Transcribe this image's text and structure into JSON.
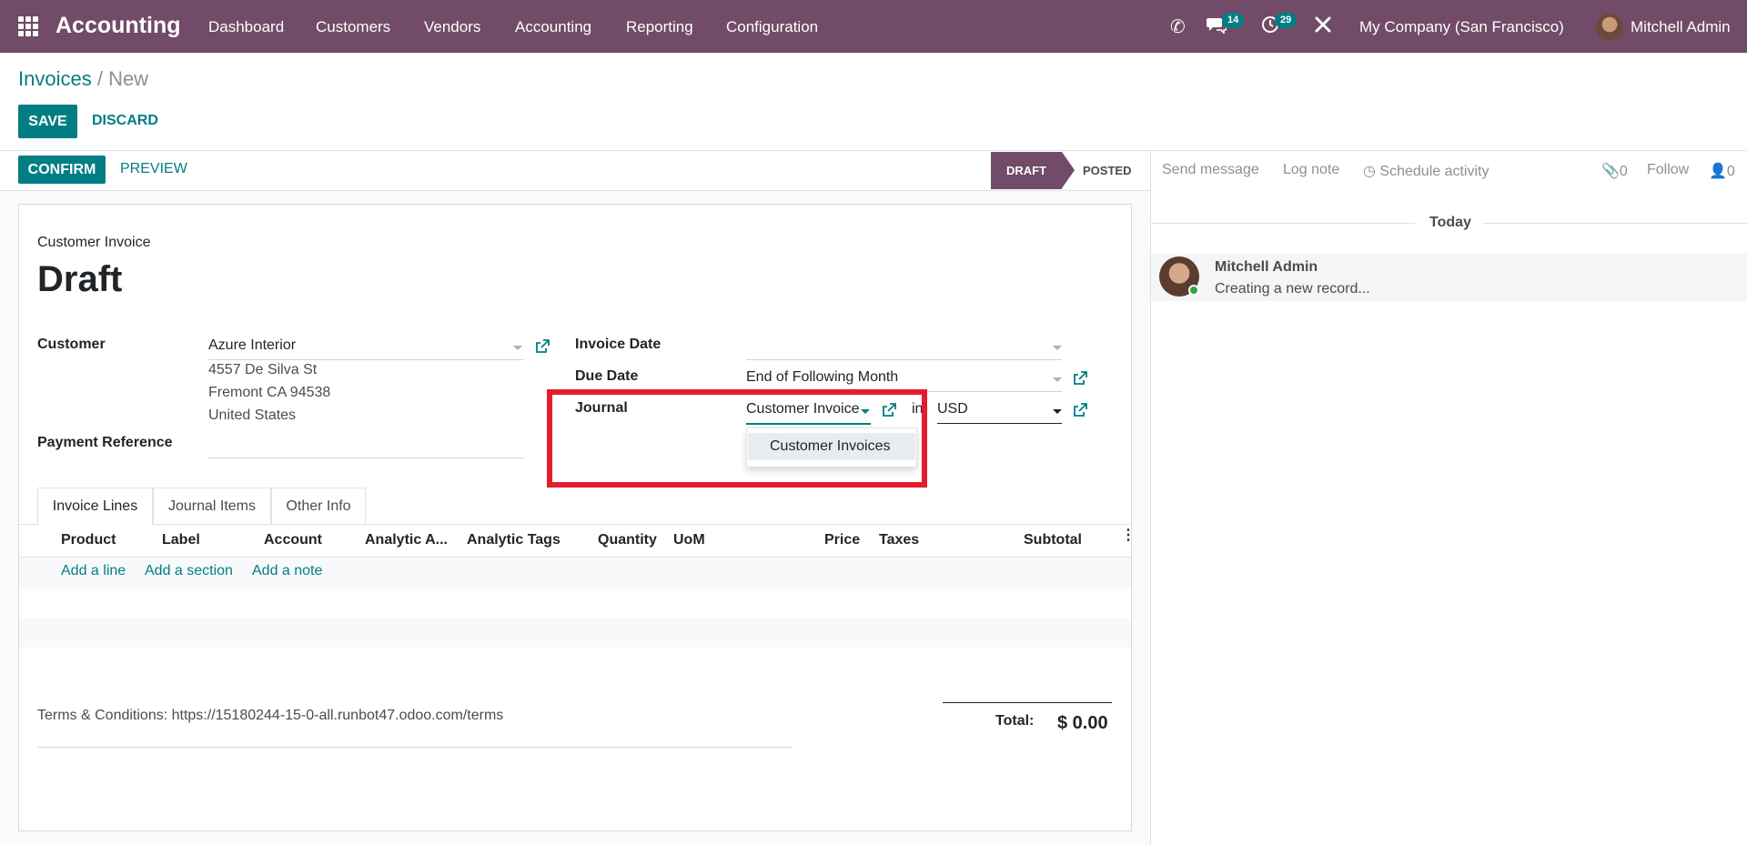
{
  "navbar": {
    "app_name": "Accounting",
    "menu": [
      "Dashboard",
      "Customers",
      "Vendors",
      "Accounting",
      "Reporting",
      "Configuration"
    ],
    "messages_count": "14",
    "activities_count": "29",
    "company": "My Company (San Francisco)",
    "user": "Mitchell Admin"
  },
  "breadcrumb": {
    "parent": "Invoices",
    "separator": " / ",
    "current": "New"
  },
  "buttons": {
    "save": "SAVE",
    "discard": "DISCARD",
    "confirm": "CONFIRM",
    "preview": "PREVIEW"
  },
  "statusbar": {
    "draft": "DRAFT",
    "posted": "POSTED"
  },
  "form": {
    "doc_type": "Customer Invoice",
    "title": "Draft",
    "customer_label": "Customer",
    "customer_value": "Azure Interior",
    "address_line1": "4557 De Silva St",
    "address_line2": "Fremont CA 94538",
    "address_line3": "United States",
    "payment_ref_label": "Payment Reference",
    "invoice_date_label": "Invoice Date",
    "due_date_label": "Due Date",
    "due_date_value": "End of Following Month",
    "journal_label": "Journal",
    "journal_value": "Customer Invoice",
    "journal_in": "in",
    "currency_value": "USD",
    "journal_dropdown_option": "Customer Invoices"
  },
  "tabs": [
    "Invoice Lines",
    "Journal Items",
    "Other Info"
  ],
  "table": {
    "columns": [
      "Product",
      "Label",
      "Account",
      "Analytic A...",
      "Analytic Tags",
      "Quantity",
      "UoM",
      "Price",
      "Taxes",
      "Subtotal"
    ],
    "add_line": "Add a line",
    "add_section": "Add a section",
    "add_note": "Add a note"
  },
  "footer": {
    "terms": "Terms & Conditions: https://15180244-15-0-all.runbot47.odoo.com/terms",
    "total_label": "Total:",
    "total_value": "$ 0.00"
  },
  "chatter": {
    "send_message": "Send message",
    "log_note": "Log note",
    "schedule_activity": "Schedule activity",
    "attachments_count": "0",
    "follow": "Follow",
    "followers_count": "0",
    "today": "Today",
    "message_author": "Mitchell Admin",
    "message_body": "Creating a new record..."
  },
  "colors": {
    "brand": "#714b67",
    "accent": "#017e84",
    "highlight": "#e41d2c"
  }
}
